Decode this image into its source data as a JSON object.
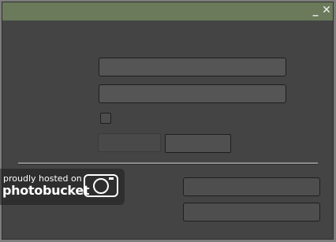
{
  "window": {
    "title": "",
    "minimize_glyph": "_",
    "close_glyph": "✕"
  },
  "form": {
    "field1_value": "",
    "field2_value": "",
    "button_left_label": "",
    "button_right_label": "",
    "field3_value": "",
    "field4_value": ""
  },
  "watermark": {
    "line1": "proudly hosted on",
    "line2": "photobucket"
  },
  "colors": {
    "titlebar": "#6a7a5a",
    "window_bg": "#444444",
    "field_bg": "#555555"
  }
}
